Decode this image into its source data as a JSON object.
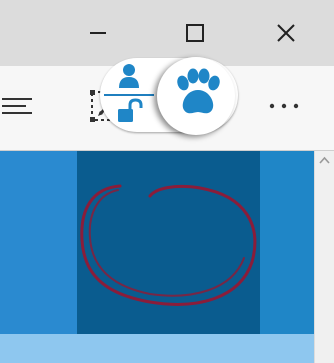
{
  "window_controls": {
    "minimize_icon": "minimize-icon",
    "maximize_icon": "maximize-icon",
    "close_icon": "close-icon"
  },
  "toolbar": {
    "icons": [
      "hub-menu-icon",
      "web-note-icon",
      "share-icon",
      "more-icon"
    ]
  },
  "extension": {
    "toggle_state": "on",
    "icons": [
      "user-icon",
      "unlock-icon",
      "paw-icon"
    ],
    "accent_color": "#1f86c7",
    "highlight_color": "#8a1d3a"
  },
  "colors": {
    "title_bar": "#dcdcdc",
    "toolbar": "#f7f7f7",
    "page_blue": "#1f86c7",
    "panel_dark": "#0a5c8f",
    "lower_band": "#8ec7ef"
  }
}
